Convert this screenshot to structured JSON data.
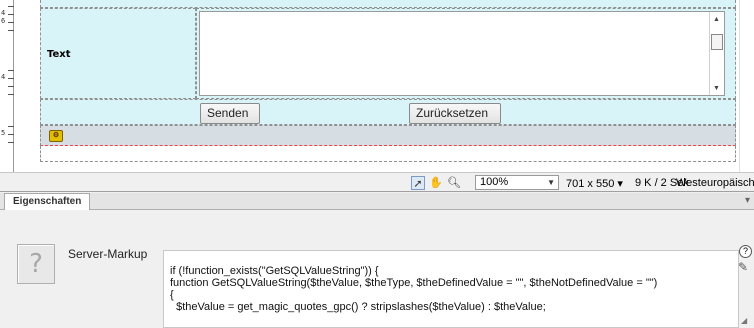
{
  "design": {
    "label_text": "Text",
    "send_button": "Senden",
    "reset_button": "Zurücksetzen",
    "server_icon": "script-marker-icon",
    "ruler_numbers": [
      "4",
      "6",
      "4",
      "5"
    ]
  },
  "statusbar": {
    "zoom": "100%",
    "window_size": "701 x 550 ▾",
    "file_info": "9 K / 2 Sek",
    "encoding": "Westeuropäisch",
    "tools": [
      "pointer-icon",
      "hand-icon",
      "zoom-icon"
    ]
  },
  "panel": {
    "tab_label": "Eigenschaften",
    "server_markup_label": "Server-Markup",
    "code_lines": [
      "if (!function_exists(\"GetSQLValueString\")) {",
      "function GetSQLValueString($theValue, $theType, $theDefinedValue = \"\", $theNotDefinedValue = \"\")",
      "{",
      "  $theValue = get_magic_quotes_gpc() ? stripslashes($theValue) : $theValue;"
    ]
  }
}
